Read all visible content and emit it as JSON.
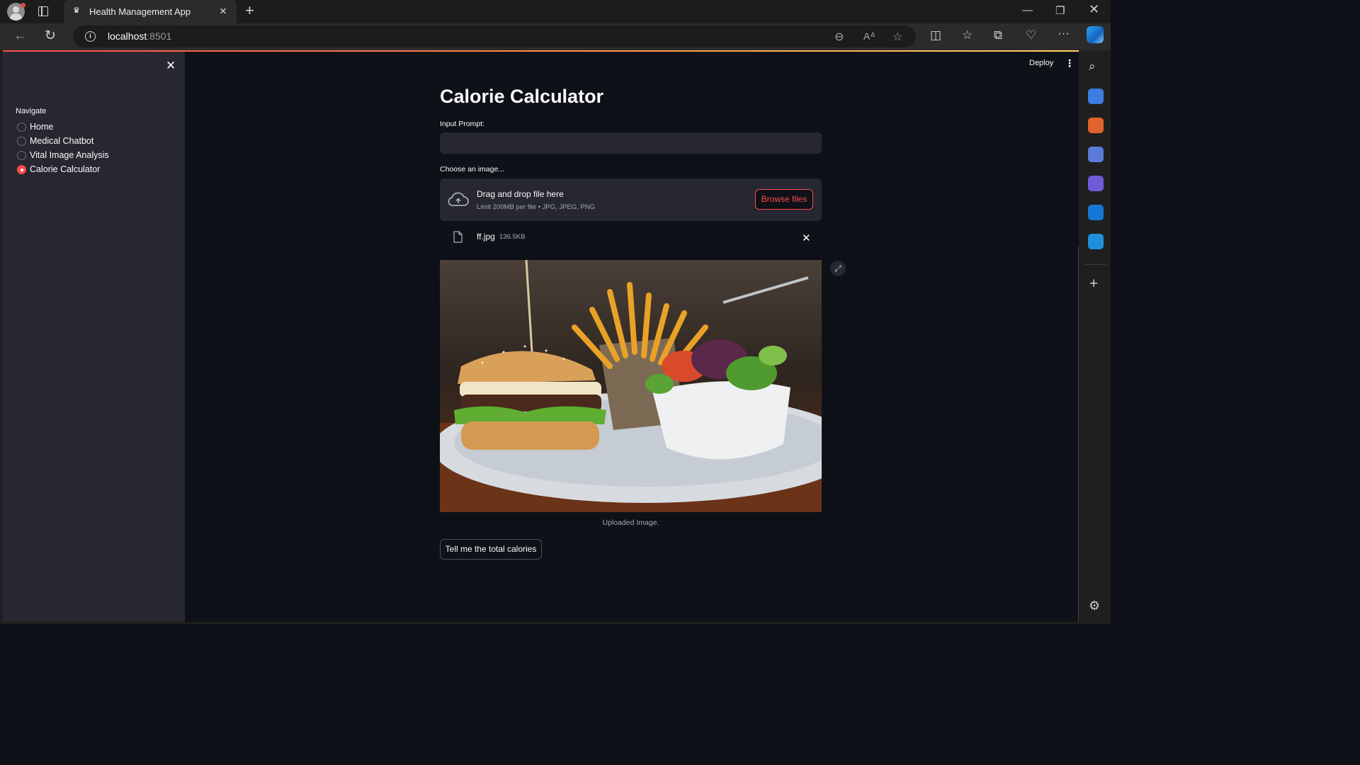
{
  "browser": {
    "tab_title": "Health Management App",
    "url_host": "localhost",
    "url_port": ":8501"
  },
  "app": {
    "deploy_label": "Deploy",
    "sidebar": {
      "nav_label": "Navigate",
      "options": [
        {
          "label": "Home",
          "selected": false
        },
        {
          "label": "Medical Chatbot",
          "selected": false
        },
        {
          "label": "Vital Image Analysis",
          "selected": false
        },
        {
          "label": "Calorie Calculator",
          "selected": true
        }
      ]
    },
    "main": {
      "title": "Calorie Calculator",
      "prompt_label": "Input Prompt:",
      "prompt_value": "",
      "uploader_label": "Choose an image...",
      "dropzone_title": "Drag and drop file here",
      "dropzone_subtitle": "Limit 200MB per file • JPG, JPEG, PNG",
      "browse_label": "Browse files",
      "file_name": "ff.jpg",
      "file_size": "136.5KB",
      "image_caption": "Uploaded Image.",
      "submit_label": "Tell me the total calories"
    }
  },
  "colors": {
    "accent": "#ff4b4b",
    "background": "#0e1117",
    "sidebar": "#262730"
  }
}
